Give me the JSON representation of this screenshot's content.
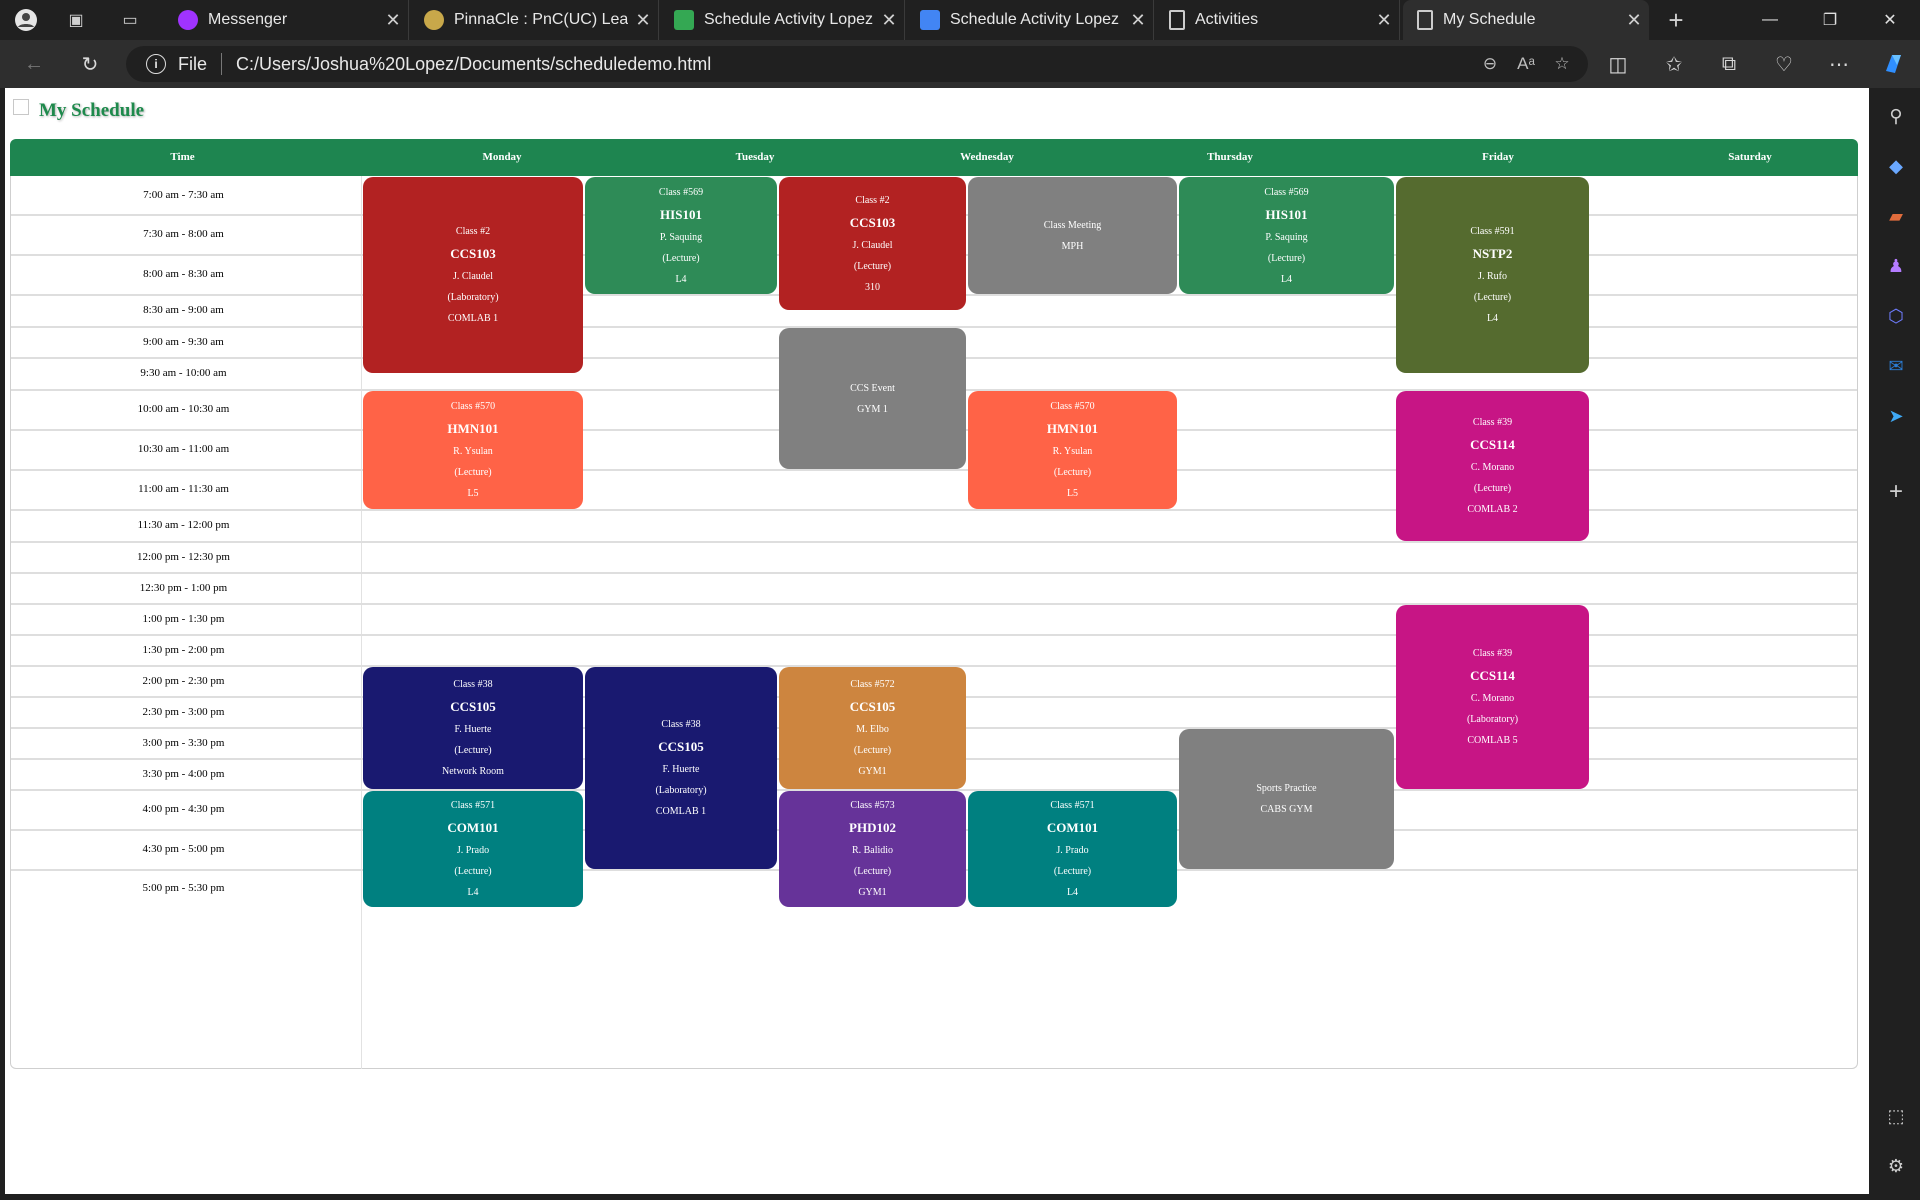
{
  "browser": {
    "tabs": [
      {
        "title": "Messenger",
        "icon": "messenger-icon",
        "color": "#a033ff"
      },
      {
        "title": "PinnaCle : PnC(UC) Learni",
        "icon": "pinnacle-icon",
        "color": "#c8a84a"
      },
      {
        "title": "Schedule Activity Lopez (",
        "icon": "google-drive-icon",
        "color": "#34a853"
      },
      {
        "title": "Schedule Activity Lopez (",
        "icon": "google-docs-icon",
        "color": "#4285f4"
      },
      {
        "title": "Activities",
        "icon": "page-icon",
        "color": "#cccccc"
      },
      {
        "title": "My Schedule",
        "icon": "page-icon",
        "color": "#cccccc"
      }
    ],
    "address": {
      "scheme": "File",
      "url": "C:/Users/Joshua%20Lopez/Documents/scheduledemo.html"
    }
  },
  "page": {
    "title": "My Schedule"
  },
  "schedule": {
    "header_color": "#1e8550",
    "time_header": "Time",
    "days": [
      "Monday",
      "Tuesday",
      "Wednesday",
      "Thursday",
      "Friday",
      "Saturday"
    ],
    "time_slots": [
      "7:00 am - 7:30 am",
      "7:30 am - 8:00 am",
      "8:00 am - 8:30 am",
      "8:30 am - 9:00 am",
      "9:00 am - 9:30 am",
      "9:30 am - 10:00 am",
      "10:00 am - 10:30 am",
      "10:30 am - 11:00 am",
      "11:00 am - 11:30 am",
      "11:30 am - 12:00 pm",
      "12:00 pm - 12:30 pm",
      "12:30 pm - 1:00 pm",
      "1:00 pm - 1:30 pm",
      "1:30 pm - 2:00 pm",
      "2:00 pm - 2:30 pm",
      "2:30 pm - 3:00 pm",
      "3:00 pm - 3:30 pm",
      "3:30 pm - 4:00 pm",
      "4:00 pm - 4:30 pm",
      "4:30 pm - 5:00 pm",
      "5:00 pm - 5:30 pm"
    ],
    "classes": [
      {
        "day": "Monday",
        "start": "7:00 am",
        "end": "9:45 am",
        "lines": [
          "Class #2",
          "CCS103",
          "J. Claudel",
          "(Laboratory)",
          "COMLAB 1"
        ],
        "color": "#b22222"
      },
      {
        "day": "Monday",
        "start": "10:00 am",
        "end": "11:30 am",
        "lines": [
          "Class #570",
          "HMN101",
          "R. Ysulan",
          "(Lecture)",
          "L5"
        ],
        "color": "#ff6347"
      },
      {
        "day": "Monday",
        "start": "2:00 pm",
        "end": "4:00 pm",
        "lines": [
          "Class #38",
          "CCS105",
          "F. Huerte",
          "(Lecture)",
          "Network Room"
        ],
        "color": "#191970"
      },
      {
        "day": "Monday",
        "start": "4:00 pm",
        "end": "5:30 pm",
        "lines": [
          "Class #571",
          "COM101",
          "J. Prado",
          "(Lecture)",
          "L4"
        ],
        "color": "#008080"
      },
      {
        "day": "Tuesday",
        "start": "7:00 am",
        "end": "8:30 am",
        "lines": [
          "Class #569",
          "HIS101",
          "P. Saquing",
          "(Lecture)",
          "L4"
        ],
        "color": "#2e8b57"
      },
      {
        "day": "Tuesday",
        "start": "2:00 pm",
        "end": "5:00 pm",
        "lines": [
          "Class #38",
          "CCS105",
          "F. Huerte",
          "(Laboratory)",
          "COMLAB 1"
        ],
        "color": "#191970"
      },
      {
        "day": "Wednesday",
        "start": "7:00 am",
        "end": "8:45 am",
        "lines": [
          "Class #2",
          "CCS103",
          "J. Claudel",
          "(Lecture)",
          "310"
        ],
        "color": "#b22222"
      },
      {
        "day": "Wednesday",
        "start": "9:00 am",
        "end": "11:00 am",
        "lines": [
          "CCS Event",
          "GYM 1"
        ],
        "color": "#808080"
      },
      {
        "day": "Wednesday",
        "start": "2:00 pm",
        "end": "4:00 pm",
        "lines": [
          "Class #572",
          "CCS105",
          "M. Elbo",
          "(Lecture)",
          "GYM1"
        ],
        "color": "#cd853f"
      },
      {
        "day": "Wednesday",
        "start": "4:00 pm",
        "end": "5:30 pm",
        "lines": [
          "Class #573",
          "PHD102",
          "R. Balidio",
          "(Lecture)",
          "GYM1"
        ],
        "color": "#663399"
      },
      {
        "day": "Thursday",
        "start": "7:00 am",
        "end": "8:30 am",
        "lines": [
          "Class Meeting",
          "MPH"
        ],
        "color": "#808080"
      },
      {
        "day": "Thursday",
        "start": "10:00 am",
        "end": "11:30 am",
        "lines": [
          "Class #570",
          "HMN101",
          "R. Ysulan",
          "(Lecture)",
          "L5"
        ],
        "color": "#ff6347"
      },
      {
        "day": "Thursday",
        "start": "4:00 pm",
        "end": "5:30 pm",
        "lines": [
          "Class #571",
          "COM101",
          "J. Prado",
          "(Lecture)",
          "L4"
        ],
        "color": "#008080"
      },
      {
        "day": "Friday",
        "start": "7:00 am",
        "end": "8:30 am",
        "lines": [
          "Class #569",
          "HIS101",
          "P. Saquing",
          "(Lecture)",
          "L4"
        ],
        "color": "#2e8b57"
      },
      {
        "day": "Friday",
        "start": "3:00 pm",
        "end": "5:00 pm",
        "lines": [
          "Sports Practice",
          "CABS GYM"
        ],
        "color": "#808080"
      },
      {
        "day": "Saturday",
        "start": "7:00 am",
        "end": "9:45 am",
        "lines": [
          "Class #591",
          "NSTP2",
          "J. Rufo",
          "(Lecture)",
          "L4"
        ],
        "color": "#556b2f"
      },
      {
        "day": "Saturday",
        "start": "10:00 am",
        "end": "12:00 pm",
        "lines": [
          "Class #39",
          "CCS114",
          "C. Morano",
          "(Lecture)",
          "COMLAB 2"
        ],
        "color": "#c71585"
      },
      {
        "day": "Saturday",
        "start": "1:00 pm",
        "end": "4:00 pm",
        "lines": [
          "Class #39",
          "CCS114",
          "C. Morano",
          "(Laboratory)",
          "COMLAB 5"
        ],
        "color": "#c71585"
      }
    ]
  }
}
